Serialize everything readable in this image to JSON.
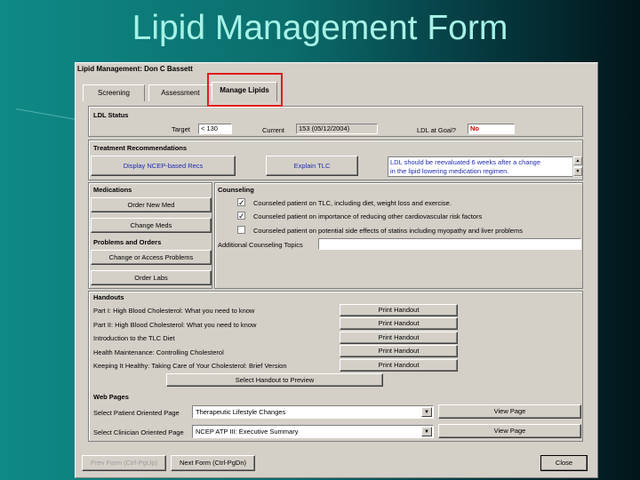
{
  "slide": {
    "title": "Lipid Management Form"
  },
  "window": {
    "title": "Lipid Management: Don C Bassett"
  },
  "tabs": [
    {
      "label": "Screening"
    },
    {
      "label": "Assessment"
    },
    {
      "label": "Manage Lipids"
    }
  ],
  "ldl_status": {
    "section_title": "LDL Status",
    "target_label": "Target",
    "target_value": "< 130",
    "current_label": "Current",
    "current_value": "153 (05/12/2004)",
    "goal_label": "LDL at Goal?",
    "goal_value": "No"
  },
  "treatment": {
    "section_title": "Treatment Recommendations",
    "display_button": "Display NCEP-based Recs",
    "explain_button": "Explain TLC",
    "note_line1": "LDL should be reevaluated 6 weeks after a change",
    "note_line2": "in the lipid lowering medication regimen."
  },
  "medications": {
    "section_title": "Medications",
    "order_new": "Order New Med",
    "change_meds": "Change Meds"
  },
  "problems": {
    "section_title": "Problems and Orders",
    "change_access": "Change or Access Problems",
    "order_labs": "Order Labs"
  },
  "counseling": {
    "section_title": "Counseling",
    "items": [
      {
        "label": "Counseled patient on TLC, including diet, weight loss and exercise.",
        "mark": "✓"
      },
      {
        "label": "Counseled patient on importance of reducing other cardiovascular risk factors",
        "mark": "✓"
      },
      {
        "label": "Counseled patient on potential side effects of statins including myopathy and liver problems",
        "mark": ""
      }
    ],
    "additional_label": "Additional Counseling Topics"
  },
  "handouts": {
    "section_title": "Handouts",
    "items": [
      {
        "label": "Part I: High Blood Cholesterol: What you need to know",
        "button": "Print Handout"
      },
      {
        "label": "Part II: High Blood Cholesterol: What you need to know",
        "button": "Print Handout"
      },
      {
        "label": "Introduction to the TLC Diet",
        "button": "Print Handout"
      },
      {
        "label": "Health Maintenance: Controlling Cholesterol",
        "button": "Print Handout"
      },
      {
        "label": "Keeping It Healthy: Taking Care of Your Cholesterol: Brief Version",
        "button": "Print Handout"
      }
    ],
    "preview_button": "Select Handout to Preview"
  },
  "web_pages": {
    "section_title": "Web Pages",
    "patient_label": "Select Patient Oriented Page",
    "patient_value": "Therapeutic Lifestyle Changes",
    "clinician_label": "Select Clinician Oriented Page",
    "clinician_value": "NCEP ATP III: Executive Summary",
    "view_button": "View Page"
  },
  "footer": {
    "prev": "Prev Form (Ctrl-PgUp)",
    "next": "Next Form (Ctrl-PgDn)",
    "close": "Close"
  },
  "colors": {
    "highlight": "#e21b1b",
    "link_blue": "#1f2bb0",
    "alert_red": "#d00000"
  }
}
